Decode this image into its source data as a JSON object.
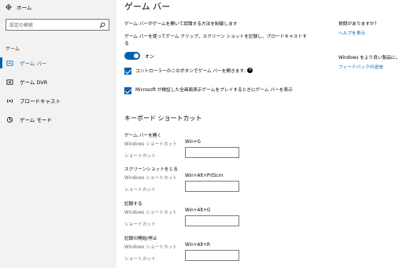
{
  "sidebar": {
    "home_label": "ホーム",
    "search_placeholder": "設定の検索",
    "group_label": "ゲーム",
    "items": [
      {
        "label": "ゲーム バー",
        "icon": "game-bar-icon",
        "active": true
      },
      {
        "label": "ゲーム DVR",
        "icon": "game-dvr-icon",
        "active": false
      },
      {
        "label": "ブロードキャスト",
        "icon": "broadcast-icon",
        "active": false
      },
      {
        "label": "ゲーム モード",
        "icon": "game-mode-icon",
        "active": false
      }
    ]
  },
  "main": {
    "title": "ゲーム バー",
    "description": "ゲーム バーがゲームを開いて認識する方法を制御します",
    "toggle_description": "ゲーム バーを使ってゲーム クリップ、スクリーン ショットを記録し、ブロードキャストする",
    "toggle_state": "オン",
    "checkbox_controller": "コントローラーのこのボタンでゲーム バーを開きます:",
    "checkbox_fullscreen": "Microsoft が検証した全画面表示ゲームをプレイするときにゲーム バーを表示",
    "shortcuts_title": "キーボード ショートカット",
    "shortcuts": [
      {
        "title": "ゲーム バーを開く",
        "windows_label": "Windows ショートカット",
        "windows_value": "Win+G",
        "shortcut_label": "ショートカット"
      },
      {
        "title": "スクリーンショットをとる",
        "windows_label": "Windows ショートカット",
        "windows_value": "Win+Alt+PrtScrn",
        "shortcut_label": "ショートカット"
      },
      {
        "title": "記録する",
        "windows_label": "Windows ショートカット",
        "windows_value": "Win+Alt+G",
        "shortcut_label": "ショートカット"
      },
      {
        "title": "記録の開始/停止",
        "windows_label": "Windows ショートカット",
        "windows_value": "Win+Alt+R",
        "shortcut_label": "ショートカット"
      }
    ]
  },
  "right": {
    "question": "質問がありますか?",
    "help_link": "ヘルプを表示",
    "improve": "Windows をより良い製品に。",
    "feedback_link": "フィードバックの送信"
  },
  "colors": {
    "accent": "#0063b1",
    "sidebar_bg": "#f2f2f2"
  }
}
